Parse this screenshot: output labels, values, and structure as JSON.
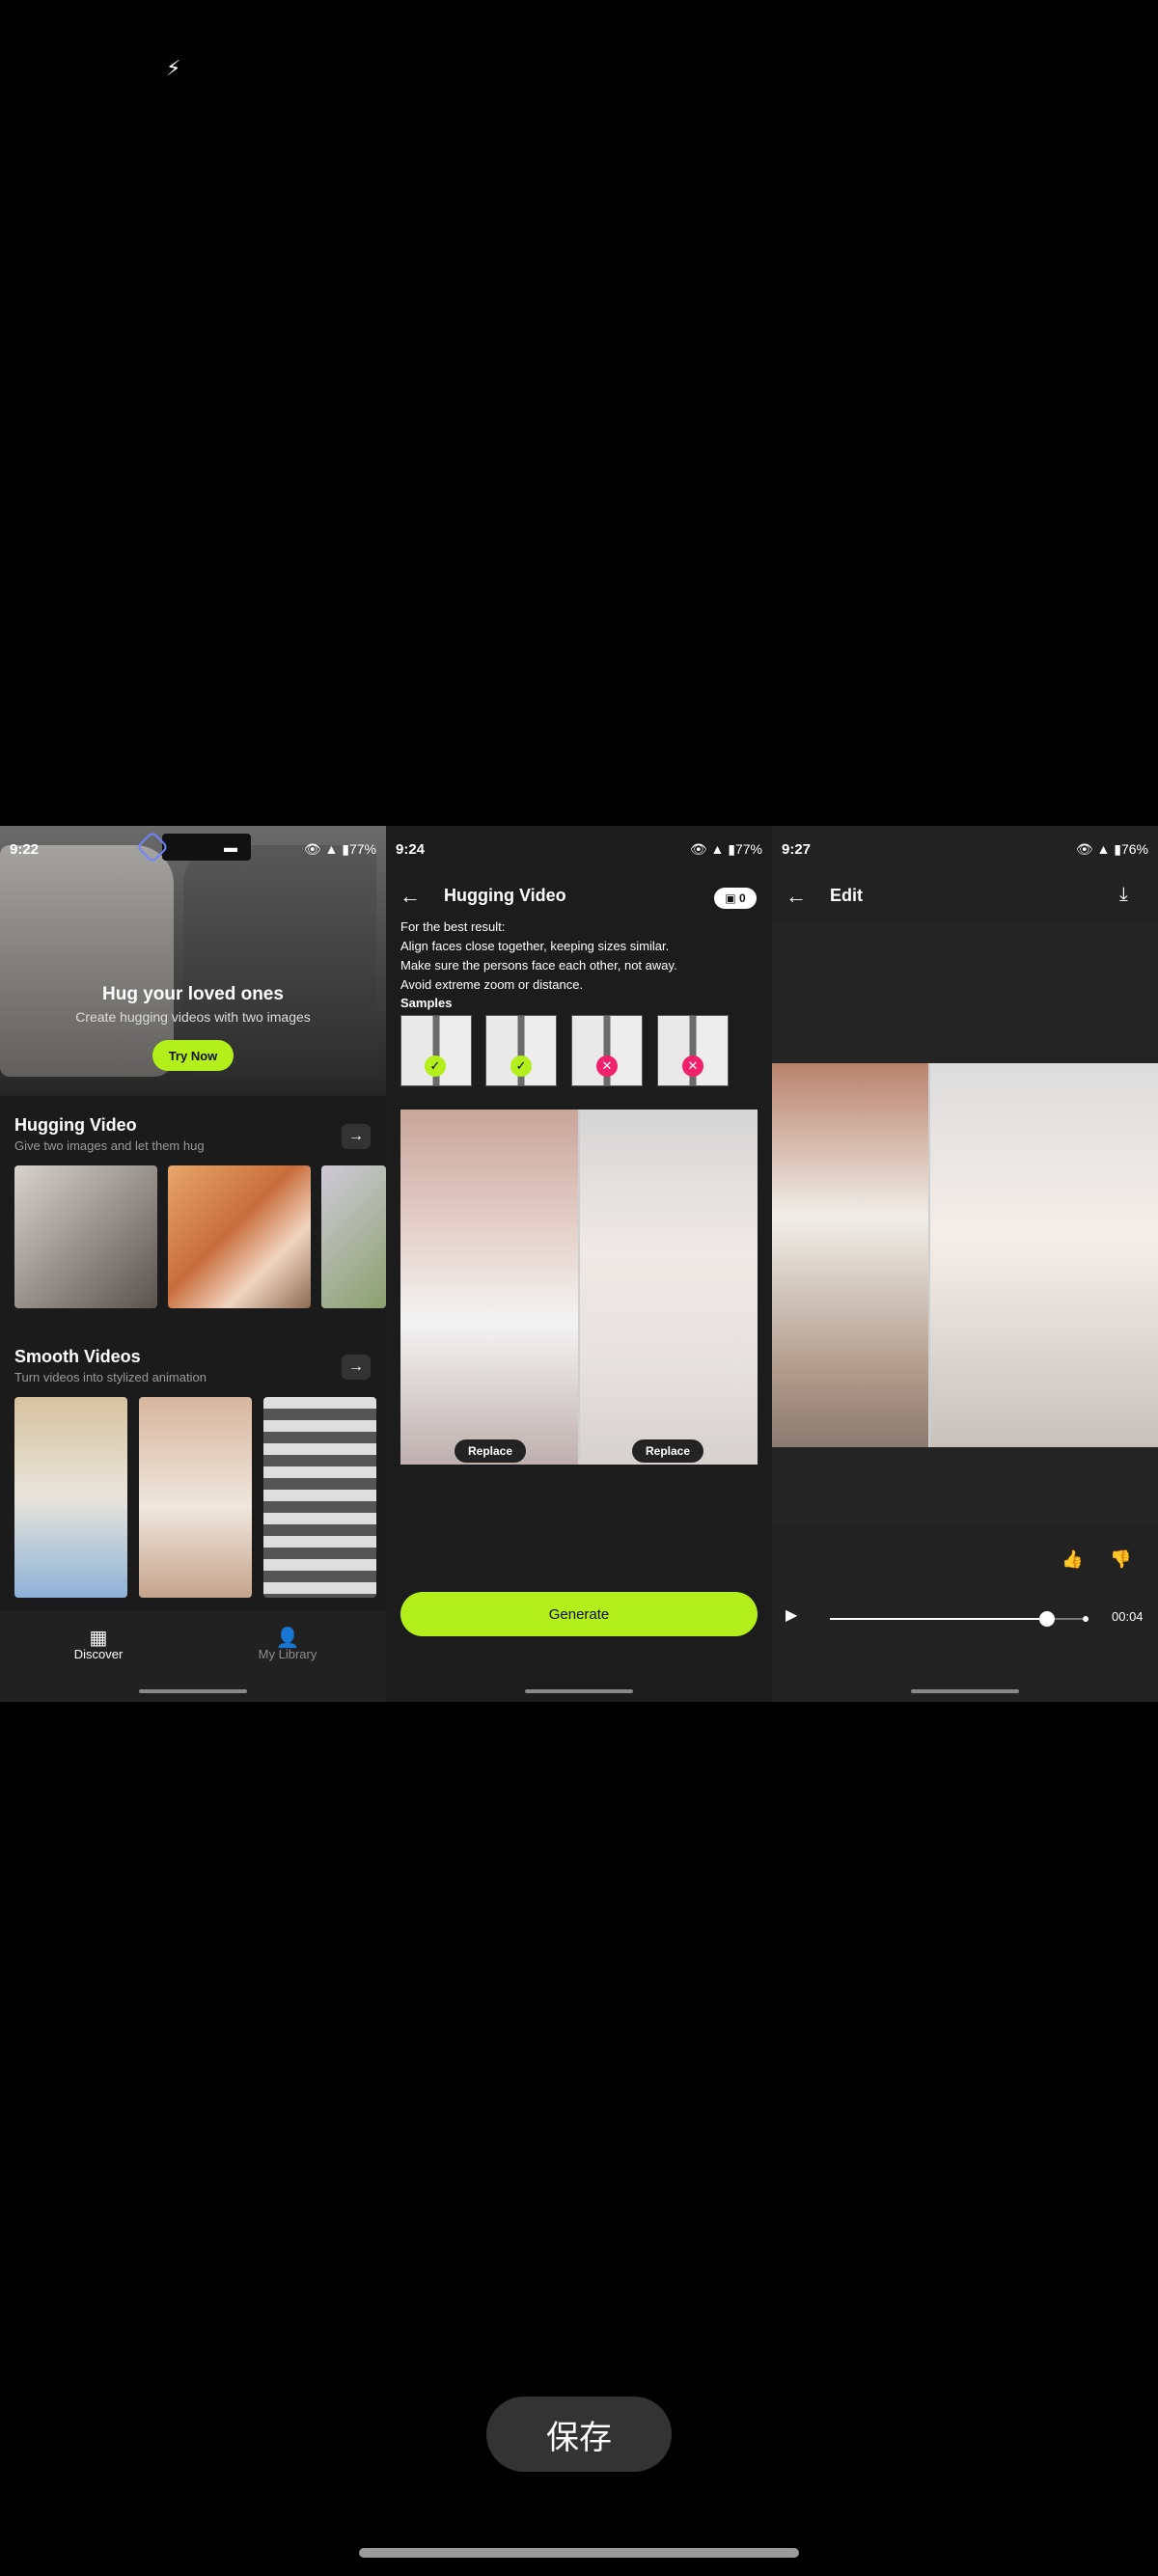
{
  "top_icon": "charging-bolt-icon",
  "panel1": {
    "status": {
      "time": "9:22",
      "right": "👁 ▲ ▮77%"
    },
    "hero": {
      "title": "Hug your loved ones",
      "subtitle": "Create hugging videos with two images",
      "button": "Try Now"
    },
    "section1": {
      "title": "Hugging Video",
      "subtitle": "Give two images and let them hug"
    },
    "section2": {
      "title": "Smooth Videos",
      "subtitle": "Turn videos into stylized animation"
    },
    "nav": {
      "discover": "Discover",
      "library": "My Library"
    }
  },
  "panel2": {
    "status": {
      "time": "9:24",
      "right": "👁 ▲ ▮77%"
    },
    "title": "Hugging Video",
    "credits": "0",
    "tips": [
      "For the best result:",
      "Align faces close together, keeping sizes similar.",
      "Make sure the persons face each other, not away.",
      "Avoid extreme zoom or distance."
    ],
    "samples_title": "Samples",
    "replace_label": "Replace",
    "generate_label": "Generate"
  },
  "panel3": {
    "status": {
      "time": "9:27",
      "right": "👁 ▲ ▮76%"
    },
    "title": "Edit",
    "progress": 0.85,
    "time_label": "00:04"
  },
  "save_label": "保存",
  "colors": {
    "accent": "#b3ef1b",
    "error": "#f2216b"
  }
}
